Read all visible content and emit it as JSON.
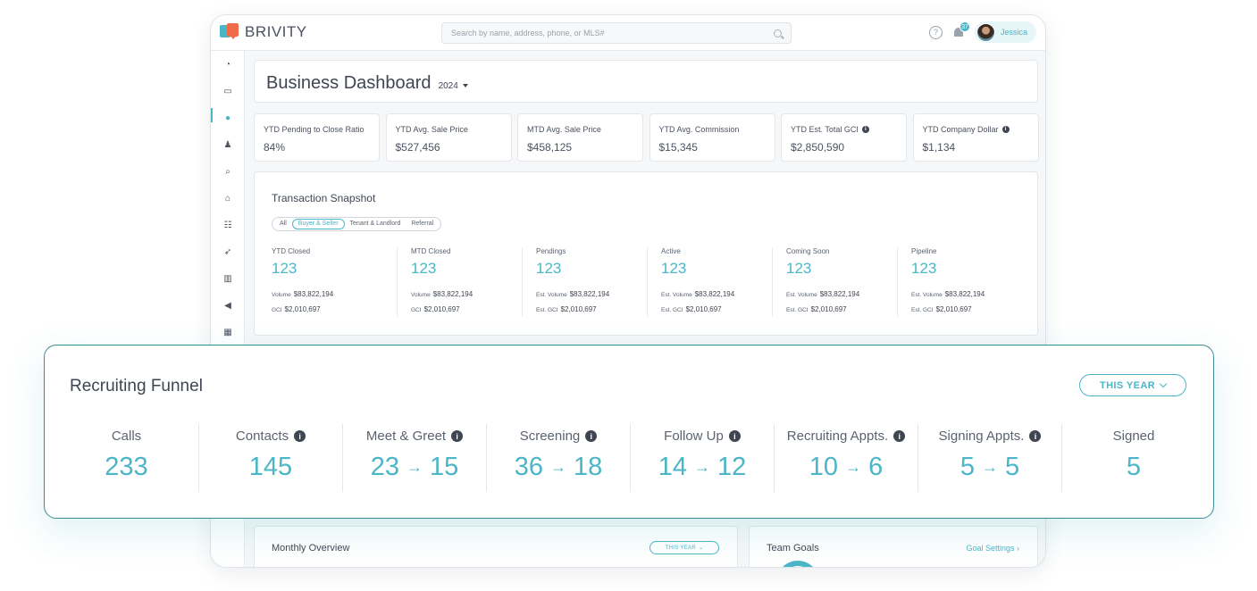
{
  "app": {
    "logo_text": "BRIVITY"
  },
  "search": {
    "placeholder": "Search by name, address, phone, or MLS#"
  },
  "header": {
    "notification_count": "37",
    "user_name": "Jessica",
    "help_glyph": "?"
  },
  "sidebar": {
    "items": [
      {
        "name": "dashboard-icon",
        "glyph": "◔"
      },
      {
        "name": "inbox-icon",
        "glyph": "▭"
      },
      {
        "name": "drop-icon",
        "glyph": "●"
      },
      {
        "name": "person-icon",
        "glyph": "♟"
      },
      {
        "name": "search-icon",
        "glyph": "⌕"
      },
      {
        "name": "home-icon",
        "glyph": "⌂"
      },
      {
        "name": "tasks-icon",
        "glyph": "☷"
      },
      {
        "name": "rocket-icon",
        "glyph": "➶"
      },
      {
        "name": "chart-icon",
        "glyph": "▥"
      },
      {
        "name": "megaphone-icon",
        "glyph": "◀"
      },
      {
        "name": "calendar-icon",
        "glyph": "▦"
      }
    ]
  },
  "dashboard": {
    "title": "Business Dashboard",
    "year": "2024"
  },
  "kpis": [
    {
      "label": "YTD Pending to Close Ratio",
      "value": "84%",
      "info": false
    },
    {
      "label": "YTD Avg. Sale Price",
      "value": "$527,456",
      "info": false
    },
    {
      "label": "MTD Avg. Sale Price",
      "value": "$458,125",
      "info": false
    },
    {
      "label": "YTD Avg. Commission",
      "value": "$15,345",
      "info": false
    },
    {
      "label": "YTD Est. Total GCI",
      "value": "$2,850,590",
      "info": true
    },
    {
      "label": "YTD Company Dollar",
      "value": "$1,134",
      "info": true
    }
  ],
  "snapshot": {
    "title": "Transaction Snapshot",
    "filters": [
      "All",
      "Buyer & Seller",
      "Tenant & Landlord",
      "Referral"
    ],
    "active_filter": "Buyer & Seller",
    "columns": [
      {
        "label": "YTD Closed",
        "count": "123",
        "vol_label": "Volume",
        "vol": "$83,822,194",
        "gci_label": "GCI",
        "gci": "$2,010,697"
      },
      {
        "label": "MTD Closed",
        "count": "123",
        "vol_label": "Volume",
        "vol": "$83,822,194",
        "gci_label": "GCI",
        "gci": "$2,010,697"
      },
      {
        "label": "Pendings",
        "count": "123",
        "vol_label": "Est. Volume",
        "vol": "$83,822,194",
        "gci_label": "Est. GCI",
        "gci": "$2,010,697"
      },
      {
        "label": "Active",
        "count": "123",
        "vol_label": "Est. Volume",
        "vol": "$83,822,194",
        "gci_label": "Est. GCI",
        "gci": "$2,010,697"
      },
      {
        "label": "Coming Soon",
        "count": "123",
        "vol_label": "Est. Volume",
        "vol": "$83,822,194",
        "gci_label": "Est. GCI",
        "gci": "$2,010,697"
      },
      {
        "label": "Pipeline",
        "count": "123",
        "vol_label": "Est. Volume",
        "vol": "$83,822,194",
        "gci_label": "Est. GCI",
        "gci": "$2,010,697"
      }
    ]
  },
  "monthly_overview": {
    "title": "Monthly Overview",
    "range_label": "THIS YEAR"
  },
  "team_goals": {
    "title": "Team Goals",
    "link": "Goal Settings",
    "link_chevron": "›"
  },
  "funnel": {
    "title": "Recruiting Funnel",
    "range_label": "THIS YEAR",
    "arrow": "→",
    "stages": [
      {
        "label": "Calls",
        "info": false,
        "from": "233",
        "to": ""
      },
      {
        "label": "Contacts",
        "info": true,
        "from": "145",
        "to": ""
      },
      {
        "label": "Meet & Greet",
        "info": true,
        "from": "23",
        "to": "15"
      },
      {
        "label": "Screening",
        "info": true,
        "from": "36",
        "to": "18"
      },
      {
        "label": "Follow Up",
        "info": true,
        "from": "14",
        "to": "12"
      },
      {
        "label": "Recruiting Appts.",
        "info": true,
        "from": "10",
        "to": "6"
      },
      {
        "label": "Signing Appts.",
        "info": true,
        "from": "5",
        "to": "5"
      },
      {
        "label": "Signed",
        "info": false,
        "from": "5",
        "to": ""
      }
    ]
  },
  "colors": {
    "accent": "#4ab6c7",
    "border_dark": "#3b8c93",
    "text": "#3f4652",
    "logo_orange": "#f06b4a"
  }
}
